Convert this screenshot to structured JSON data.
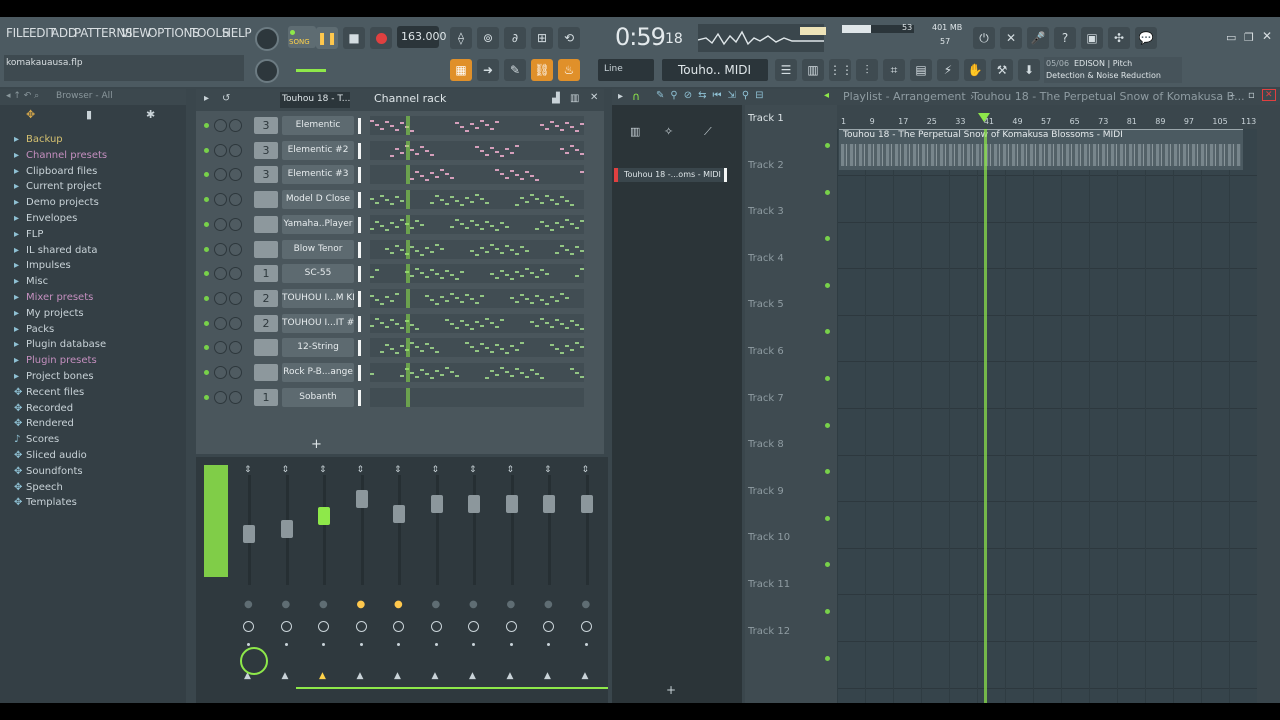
{
  "app": {
    "menu": [
      "FILE",
      "EDIT",
      "ADD",
      "PATTERNS",
      "VIEW",
      "OPTIONS",
      "TOOLS",
      "HELP"
    ],
    "project_file": "komakauausa.flp",
    "mode": "SONG",
    "tempo": "163.000",
    "time": "0:59",
    "time_small": "18",
    "cpu_value": "53",
    "mem_value": "401 MB",
    "poly_value": "57",
    "snap": "Line",
    "pattern_name": "Touho.. MIDI",
    "hint_index": "05/06",
    "hint_title": "EDISON | Pitch",
    "hint_text": "Detection & Noise Reduction"
  },
  "browser": {
    "title": "Browser - All",
    "items": [
      {
        "label": "Backup",
        "color": "#d4c070"
      },
      {
        "label": "Channel presets",
        "color": "#c48fbf"
      },
      {
        "label": "Clipboard files",
        "color": "#c9d3d8"
      },
      {
        "label": "Current project",
        "color": "#c9d3d8"
      },
      {
        "label": "Demo projects",
        "color": "#c9d3d8"
      },
      {
        "label": "Envelopes",
        "color": "#c9d3d8"
      },
      {
        "label": "FLP",
        "color": "#c9d3d8"
      },
      {
        "label": "IL shared data",
        "color": "#c9d3d8"
      },
      {
        "label": "Impulses",
        "color": "#c9d3d8"
      },
      {
        "label": "Misc",
        "color": "#c9d3d8"
      },
      {
        "label": "Mixer presets",
        "color": "#c48fbf"
      },
      {
        "label": "My projects",
        "color": "#c9d3d8"
      },
      {
        "label": "Packs",
        "color": "#c9d3d8"
      },
      {
        "label": "Plugin database",
        "color": "#c9d3d8"
      },
      {
        "label": "Plugin presets",
        "color": "#c48fbf"
      },
      {
        "label": "Project bones",
        "color": "#c9d3d8"
      },
      {
        "label": "Recent files",
        "color": "#c9d3d8"
      },
      {
        "label": "Recorded",
        "color": "#c9d3d8"
      },
      {
        "label": "Rendered",
        "color": "#c9d3d8"
      },
      {
        "label": "Scores",
        "color": "#c9d3d8"
      },
      {
        "label": "Sliced audio",
        "color": "#c9d3d8"
      },
      {
        "label": "Soundfonts",
        "color": "#c9d3d8"
      },
      {
        "label": "Speech",
        "color": "#c9d3d8"
      },
      {
        "label": "Templates",
        "color": "#c9d3d8"
      }
    ]
  },
  "channel_rack": {
    "title": "Channel rack",
    "pattern_selector": "Touhou 18 - T...",
    "channels": [
      {
        "num": "3",
        "name": "Elementic"
      },
      {
        "num": "3",
        "name": "Elementic #2"
      },
      {
        "num": "3",
        "name": "Elementic #3"
      },
      {
        "num": "",
        "name": "Model D Close"
      },
      {
        "num": "",
        "name": "Yamaha..Player"
      },
      {
        "num": "",
        "name": "Blow Tenor"
      },
      {
        "num": "1",
        "name": "SC-55"
      },
      {
        "num": "2",
        "name": "TOUHOU I...M KIT"
      },
      {
        "num": "2",
        "name": "TOUHOU I...IT #2"
      },
      {
        "num": "",
        "name": "12-String"
      },
      {
        "num": "",
        "name": "Rock P-B...ange"
      },
      {
        "num": "1",
        "name": "Sobanth"
      }
    ],
    "add_label": "+"
  },
  "playlist": {
    "title": "Playlist - Arrangement",
    "song": "Touhou 18 - The Perpetual Snow of Komakusa B...",
    "picker_item": "Touhou 18 -...oms - MIDI",
    "clip_label": "Touhou 18 - The Perpetual Snow of Komakusa Blossoms - MIDI",
    "ruler": [
      "1",
      "9",
      "17",
      "25",
      "33",
      "41",
      "49",
      "57",
      "65",
      "73",
      "81",
      "89",
      "97",
      "105",
      "113"
    ],
    "tracks": [
      "Track 1",
      "Track 2",
      "Track 3",
      "Track 4",
      "Track 5",
      "Track 6",
      "Track 7",
      "Track 8",
      "Track 9",
      "Track 10",
      "Track 11",
      "Track 12"
    ],
    "playhead_fraction": 0.35
  },
  "colors": {
    "accent_green": "#8ee84a",
    "record_red": "#e04040",
    "pattern_pink": "#e6a9c6",
    "pattern_green": "#9bd388"
  }
}
